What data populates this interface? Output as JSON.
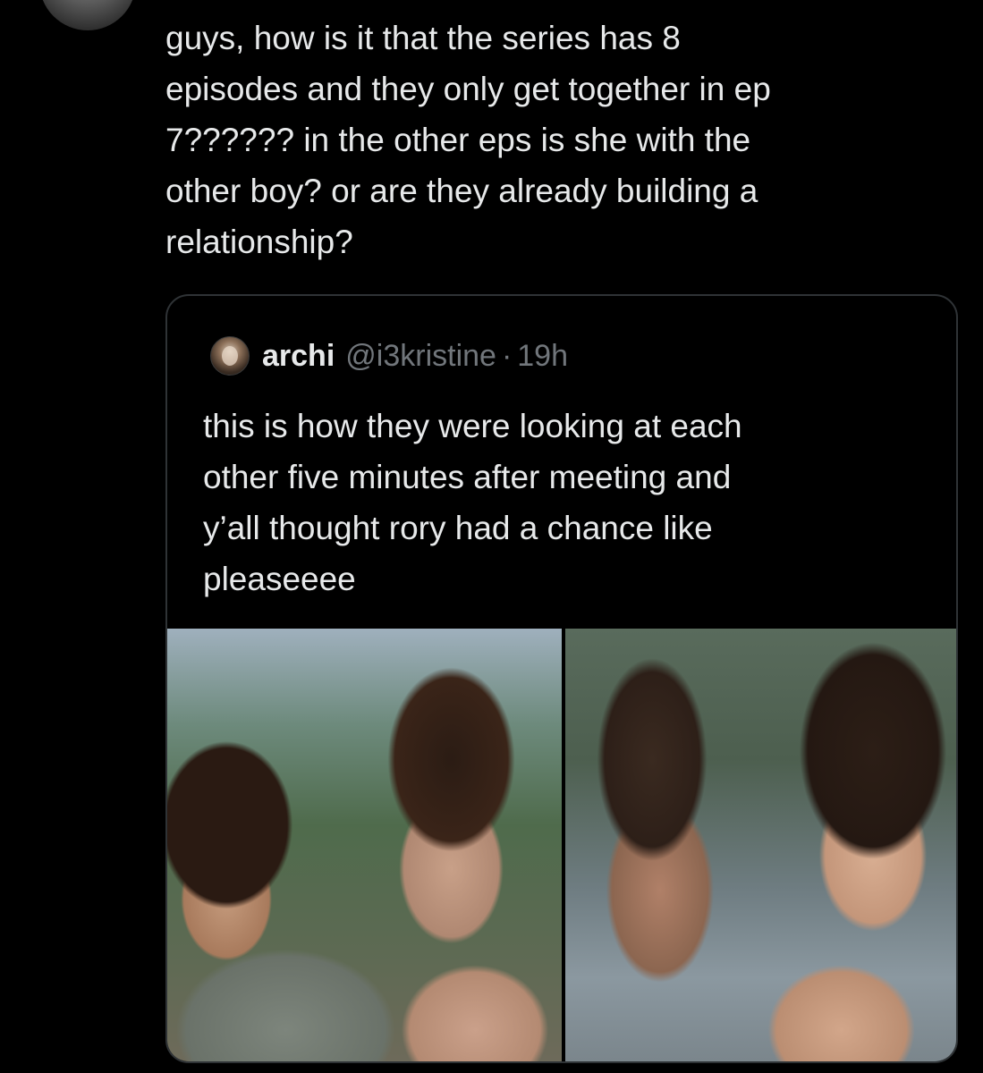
{
  "tweet": {
    "text": "guys, how is it that the series has 8\nepisodes and they only get together in ep\n7?????? in the other eps is she with the\nother boy? or are they already building a\nrelationship?"
  },
  "quoted_tweet": {
    "display_name": "archi",
    "handle": "@i3kristine",
    "separator": "·",
    "time": "19h",
    "text": "this is how they were looking at each\nother five minutes after meeting and\ny’all thought rory had a chance like\npleaseeee",
    "media": [
      "photo-left",
      "photo-right"
    ]
  },
  "colors": {
    "background": "#000000",
    "text_primary": "#e7e9ea",
    "text_secondary": "#71767b",
    "border": "#2f3336"
  }
}
